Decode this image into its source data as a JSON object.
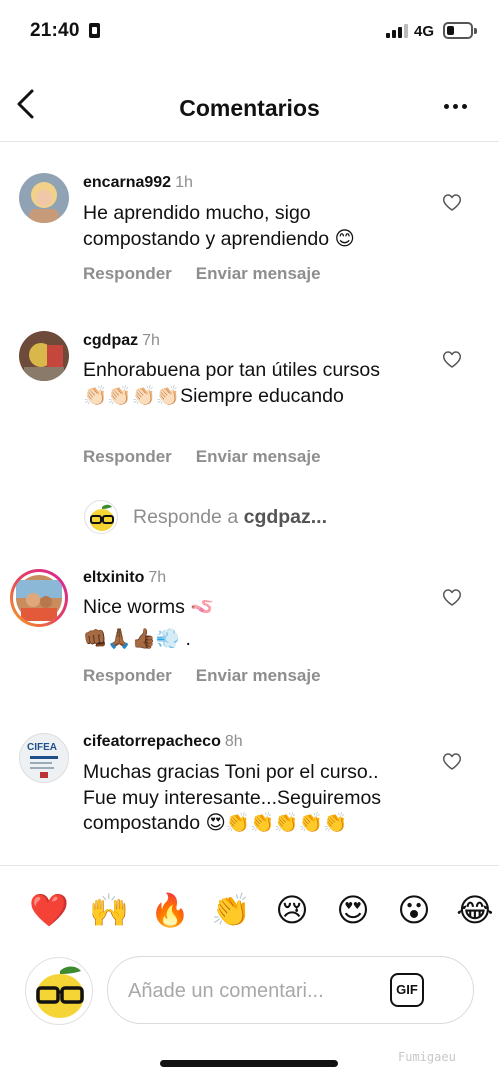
{
  "status_bar": {
    "time": "21:40",
    "network": "4G"
  },
  "header": {
    "title": "Comentarios",
    "back_icon": "chevron-left-icon",
    "more_icon": "more-horizontal-icon"
  },
  "comments": [
    {
      "username": "encarna992",
      "time": "1h",
      "text": "He aprendido mucho, sigo compostando y aprendiendo 😊",
      "reply_label": "Responder",
      "message_label": "Enviar mensaje"
    },
    {
      "username": "cgdpaz",
      "time": "7h",
      "text": "Enhorabuena por tan útiles cursos 👏🏻👏🏻👏🏻👏🏻Siempre educando",
      "reply_label": "Responder",
      "message_label": "Enviar mensaje"
    },
    {
      "username": "eltxinito",
      "time": "7h",
      "text_line1": "Nice worms 🪱",
      "text_line2": "👊🏾🙏🏾👍🏾💨 .",
      "reply_label": "Responder",
      "message_label": "Enviar mensaje"
    },
    {
      "username": "cifeatorrepacheco",
      "time": "8h",
      "text": "Muchas gracias Toni por el curso.. Fue muy interesante...Seguiremos compostando 😍👏👏👏👏👏",
      "avatar_text": "CIFEA"
    }
  ],
  "reply_prompt": {
    "prefix": "Responde a ",
    "username": "cgdpaz..."
  },
  "emoji_bar": [
    "❤️",
    "🙌",
    "🔥",
    "👏",
    "😢",
    "😍",
    "😮",
    "😂"
  ],
  "composer": {
    "placeholder": "Añade un comentari...",
    "gif_label": "GIF"
  },
  "watermark": "Fumigaeu",
  "colors": {
    "text": "#111111",
    "secondary": "#8e8e8e",
    "border": "#dbdbdb",
    "story_ring_start": "#f9a31f",
    "story_ring_end": "#d6249f"
  }
}
